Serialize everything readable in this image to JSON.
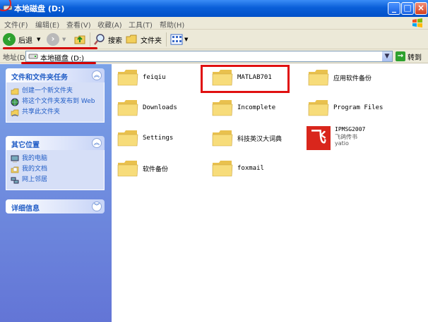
{
  "window": {
    "title": "本地磁盘 (D:)"
  },
  "menubar": {
    "items": [
      "文件(F)",
      "编辑(E)",
      "查看(V)",
      "收藏(A)",
      "工具(T)",
      "帮助(H)"
    ]
  },
  "toolbar": {
    "back_label": "后退",
    "search_label": "搜索",
    "folders_label": "文件夹"
  },
  "address": {
    "label": "地址(D)",
    "value": "本地磁盘 (D:)",
    "go_label": "转到"
  },
  "taskpane": {
    "file_tasks": {
      "title": "文件和文件夹任务",
      "items": [
        "创建一个新文件夹",
        "将这个文件夹发布到 Web",
        "共享此文件夹"
      ]
    },
    "other_places": {
      "title": "其它位置",
      "items": [
        "我的电脑",
        "我的文档",
        "网上邻居"
      ]
    },
    "details": {
      "title": "详细信息"
    }
  },
  "files": [
    {
      "name": "feiqiu"
    },
    {
      "name": "MATLAB701"
    },
    {
      "name": "应用软件备份"
    },
    {
      "name": "Downloads"
    },
    {
      "name": "Incomplete"
    },
    {
      "name": "Program Files"
    },
    {
      "name": "Settings"
    },
    {
      "name": "科技英汉大词典"
    },
    {
      "name": "软件备份"
    },
    {
      "name": "foxmail"
    }
  ],
  "special_item": {
    "name": "IPMSG2007",
    "line2": "飞鸽传书",
    "line3": "yatio",
    "logo_glyph": "飞"
  },
  "colors": {
    "title_bar": "#0a5fd8",
    "task_pane": "#6375d6",
    "highlight": "#e01010",
    "folder": "#f5d66b"
  }
}
